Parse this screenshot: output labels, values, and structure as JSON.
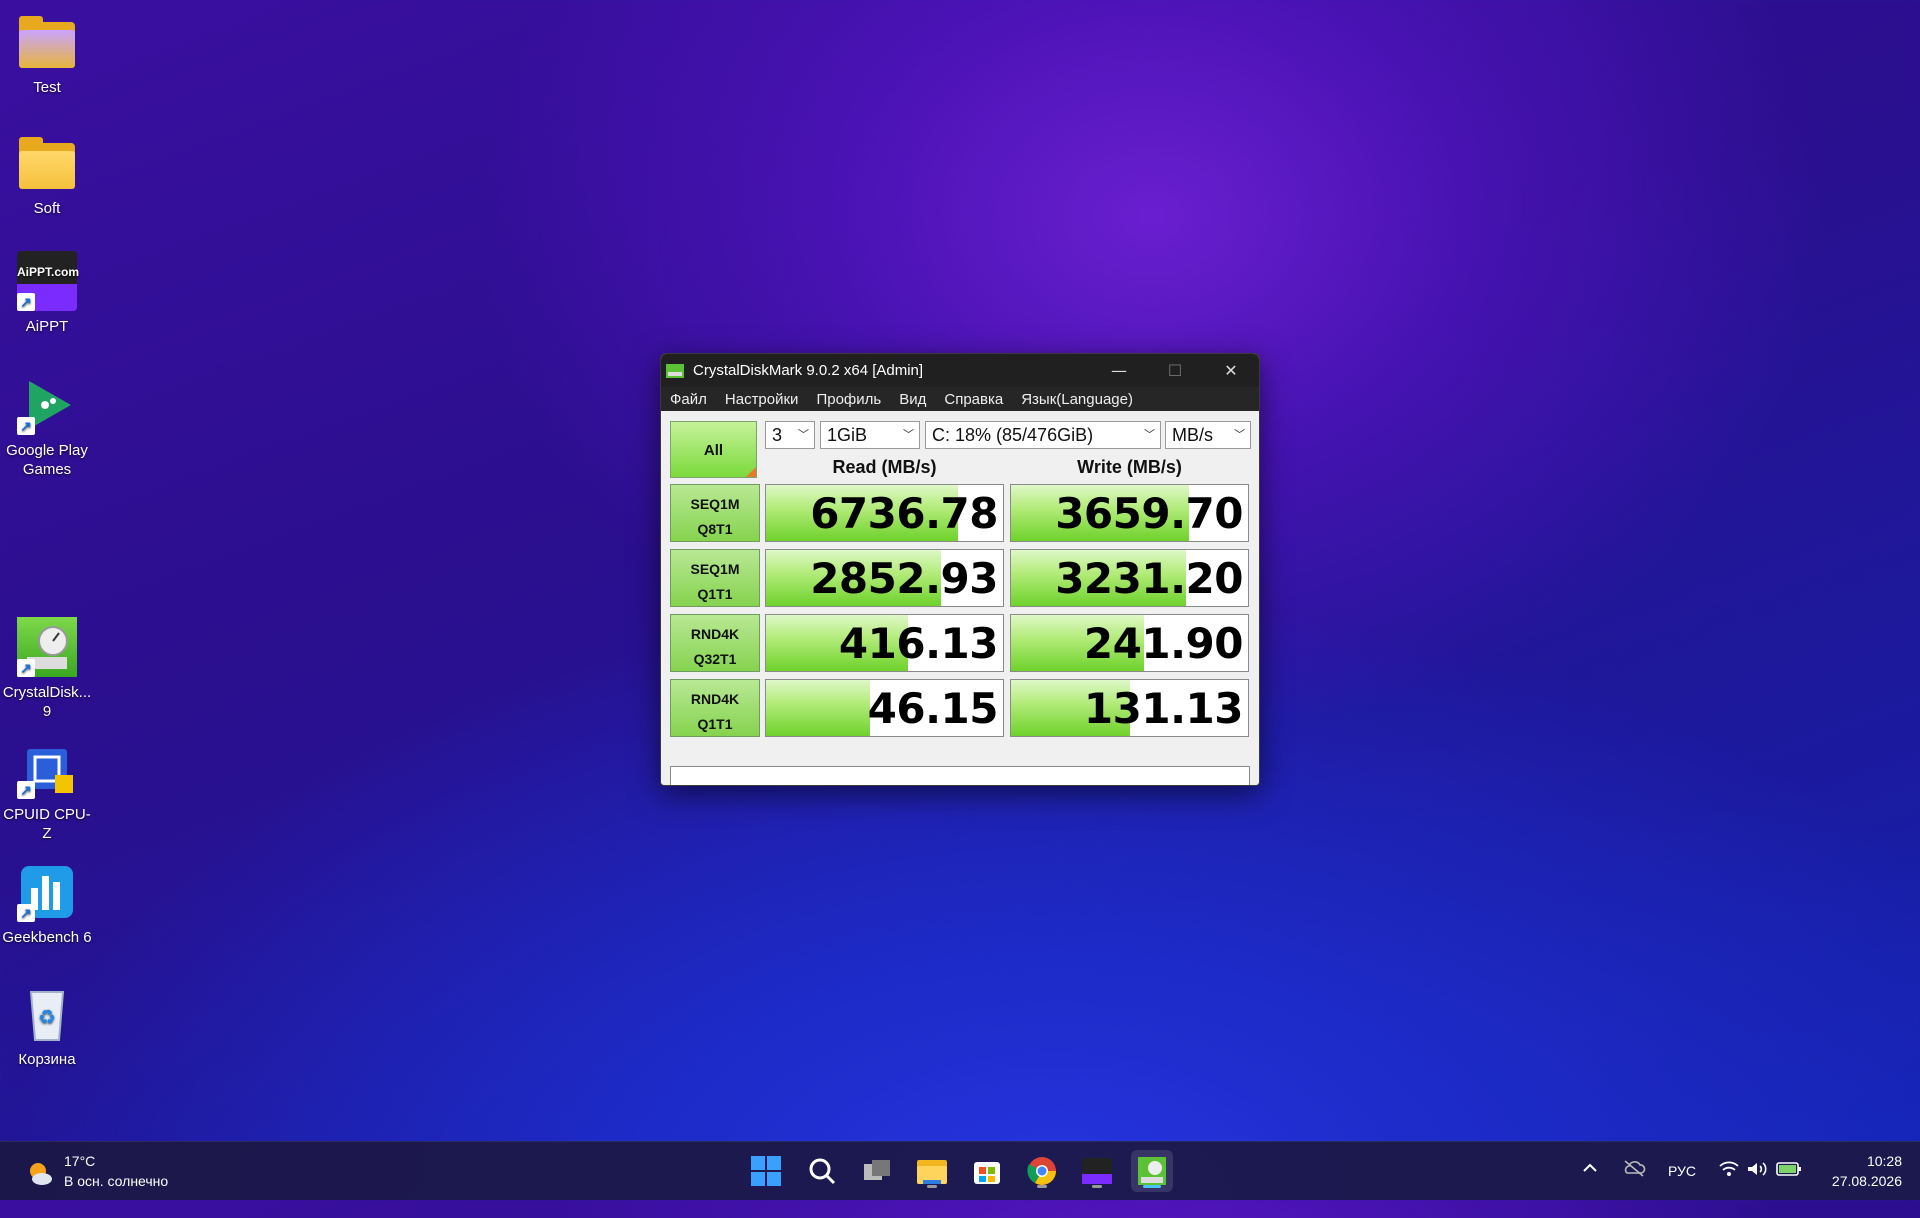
{
  "desktop": {
    "icons": [
      {
        "label": "Test",
        "icon": "folder-icon"
      },
      {
        "label": "Soft",
        "icon": "folder-icon"
      },
      {
        "label": "AiPPT",
        "icon": "aippt-app-icon",
        "art_text": "AiPPT.com"
      },
      {
        "label": "Google Play Games",
        "icon": "google-play-games-icon"
      },
      {
        "label": "CrystalDisk... 9",
        "icon": "crystaldiskmark-icon"
      },
      {
        "label": "CPUID CPU-Z",
        "icon": "cpu-z-icon"
      },
      {
        "label": "Geekbench 6",
        "icon": "geekbench-icon"
      },
      {
        "label": "Корзина",
        "icon": "recycle-bin-icon"
      }
    ]
  },
  "window": {
    "title": "CrystalDiskMark 9.0.2 x64 [Admin]",
    "controls": {
      "minimize": "—",
      "maximize": "☐",
      "close": "✕"
    },
    "menu": [
      "Файл",
      "Настройки",
      "Профиль",
      "Вид",
      "Справка",
      "Язык(Language)"
    ],
    "all_button": "All",
    "count": "3",
    "size": "1GiB",
    "drive": "C: 18% (85/476GiB)",
    "unit": "MB/s",
    "read_header": "Read (MB/s)",
    "write_header": "Write (MB/s)",
    "tests": [
      {
        "line1": "SEQ1M",
        "line2": "Q8T1",
        "read": "6736.78",
        "write": "3659.70",
        "read_fill": 0.81,
        "write_fill": 0.75
      },
      {
        "line1": "SEQ1M",
        "line2": "Q1T1",
        "read": "2852.93",
        "write": "3231.20",
        "read_fill": 0.74,
        "write_fill": 0.74
      },
      {
        "line1": "RND4K",
        "line2": "Q32T1",
        "read": "416.13",
        "write": "241.90",
        "read_fill": 0.6,
        "write_fill": 0.56
      },
      {
        "line1": "RND4K",
        "line2": "Q1T1",
        "read": "46.15",
        "write": "131.13",
        "read_fill": 0.44,
        "write_fill": 0.5
      }
    ],
    "comment": ""
  },
  "taskbar": {
    "weather": {
      "temp": "17°C",
      "desc": "В осн. солнечно"
    },
    "apps": [
      "windows-start-icon",
      "search-icon",
      "task-view-icon",
      "file-explorer-icon",
      "microsoft-store-icon",
      "chrome-icon",
      "aippt-taskbar-icon",
      "crystaldiskmark-taskbar-icon"
    ],
    "language": "РУС",
    "time": "10:28",
    "date": "27.08.2026"
  },
  "colors": {
    "accent_green": "#6fd22b",
    "titlebar": "#202020",
    "taskbar": "#1c1844"
  }
}
